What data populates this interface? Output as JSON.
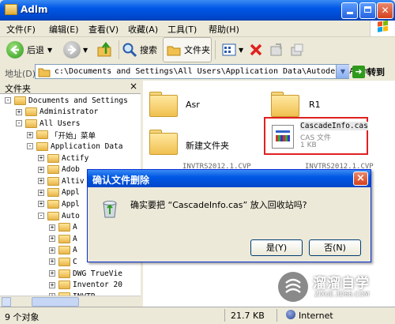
{
  "window": {
    "title": "Adlm"
  },
  "menubar": {
    "items": [
      "文件(F)",
      "编辑(E)",
      "查看(V)",
      "收藏(A)",
      "工具(T)",
      "帮助(H)"
    ]
  },
  "toolbar": {
    "back": "后退",
    "search": "搜索",
    "folders": "文件夹"
  },
  "address": {
    "label": "地址(D)",
    "path": "c:\\Documents and Settings\\All Users\\Application Data\\Autodesk\\Adlm",
    "go": "转到"
  },
  "folders_pane": {
    "title": "文件夹",
    "close": "×",
    "tree": [
      {
        "label": "Documents and Settings",
        "sign": "-"
      },
      {
        "label": "Administrator",
        "sign": "+"
      },
      {
        "label": "All Users",
        "sign": "-"
      },
      {
        "label": "「开始」菜单",
        "sign": "+"
      },
      {
        "label": "Application Data",
        "sign": "-"
      },
      {
        "label": "Actify",
        "sign": "+"
      },
      {
        "label": "Adob",
        "sign": "+"
      },
      {
        "label": "Altiv",
        "sign": "+"
      },
      {
        "label": "Appl",
        "sign": "+"
      },
      {
        "label": "Appl",
        "sign": "+"
      },
      {
        "label": "Auto",
        "sign": "-"
      },
      {
        "label": "A",
        "sign": "+"
      },
      {
        "label": "A",
        "sign": "+"
      },
      {
        "label": "A",
        "sign": "+"
      },
      {
        "label": "C",
        "sign": "+"
      },
      {
        "label": "DWG TrueVie",
        "sign": "+"
      },
      {
        "label": "Inventor 20",
        "sign": "+"
      },
      {
        "label": "INVTR",
        "sign": "+"
      }
    ]
  },
  "files": {
    "asr": "Asr",
    "r1": "R1",
    "newfolder": "新建文件夹",
    "cas_name": "CascadeInfo.cas",
    "cas_type": "CAS 文件",
    "cas_size": "1 KB",
    "partial1": "INVTRS2012.1.CVP",
    "partial2": "INVTRS2012.1.CVP"
  },
  "dialog": {
    "title": "确认文件删除",
    "message": "确实要把 “CascadeInfo.cas” 放入回收站吗?",
    "yes": "是(Y)",
    "no": "否(N)",
    "close": "×"
  },
  "status": {
    "count": "9 个对象",
    "size": "21.7 KB",
    "zone": "Internet"
  },
  "watermark": {
    "brand": "溜溜自学",
    "url": "ZIXUE.3D66.COM"
  }
}
